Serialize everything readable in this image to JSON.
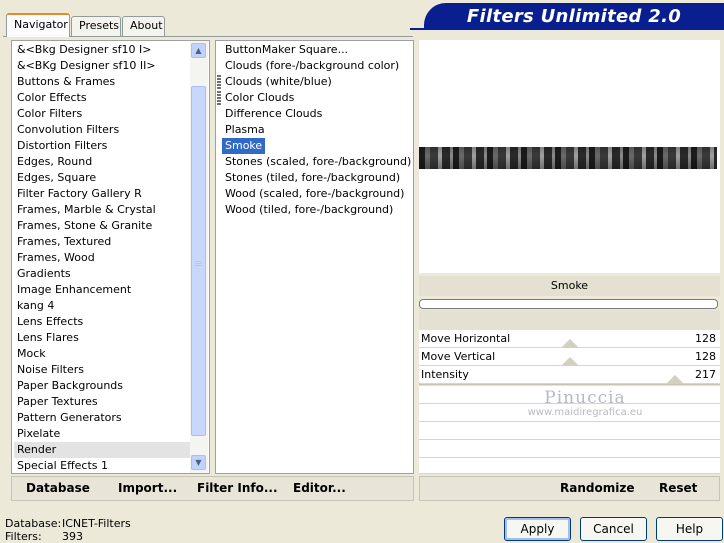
{
  "tabs": [
    "Navigator",
    "Presets",
    "About"
  ],
  "title": "Filters Unlimited 2.0",
  "categories": [
    "&<Bkg Designer sf10 I>",
    "&<BKg Designer sf10 II>",
    "Buttons & Frames",
    "Color Effects",
    "Color Filters",
    "Convolution Filters",
    "Distortion Filters",
    "Edges, Round",
    "Edges, Square",
    "Filter Factory Gallery R",
    "Frames, Marble & Crystal",
    "Frames, Stone & Granite",
    "Frames, Textured",
    "Frames, Wood",
    "Gradients",
    "Image Enhancement",
    "kang 4",
    "Lens Effects",
    "Lens Flares",
    "Mock",
    "Noise Filters",
    "Paper Backgrounds",
    "Paper Textures",
    "Pattern Generators",
    "Pixelate",
    "Render",
    "Special Effects 1"
  ],
  "selected_category": "Render",
  "filters": [
    "ButtonMaker Square...",
    "Clouds (fore-/background color)",
    "Clouds (white/blue)",
    "Color Clouds",
    "Difference Clouds",
    "Plasma",
    "Smoke",
    "Stones (scaled, fore-/background)",
    "Stones (tiled, fore-/background)",
    "Wood (scaled, fore-/background)",
    "Wood (tiled, fore-/background)"
  ],
  "selected_filter": "Smoke",
  "toolbar_left": [
    "Database",
    "Import...",
    "Filter Info...",
    "Editor..."
  ],
  "toolbar_right": [
    "Randomize",
    "Reset"
  ],
  "current_filter_name": "Smoke",
  "params": [
    {
      "label": "Move Horizontal",
      "value": "128",
      "level": 0.5
    },
    {
      "label": "Move Vertical",
      "value": "128",
      "level": 0.5
    },
    {
      "label": "Intensity",
      "value": "217",
      "level": 0.85
    }
  ],
  "watermark": {
    "line1": "Pinuccia",
    "line2": "www.maidiregrafica.eu"
  },
  "info": {
    "database_label": "Database:",
    "database_value": "ICNET-Filters",
    "filters_label": "Filters:",
    "filters_value": "393"
  },
  "buttons": {
    "apply": "Apply",
    "cancel": "Cancel",
    "help": "Help"
  },
  "colors": {
    "banner": "#0a1f8f",
    "selection": "#316ac5",
    "tab_accent": "#e68b2c"
  }
}
